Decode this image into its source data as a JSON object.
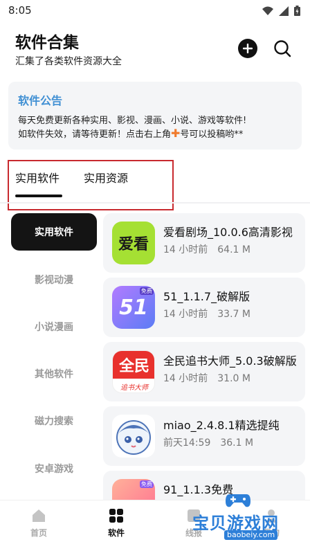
{
  "status_bar": {
    "time": "8:05"
  },
  "header": {
    "title": "软件合集",
    "subtitle": "汇集了各类软件资源大全"
  },
  "notice": {
    "title": "软件公告",
    "line1": "每天免费更新各种实用、影视、漫画、小说、游戏等软件!",
    "line2_pre": "如软件失效，请等待更新！点击右上角",
    "plus": "✚",
    "line2_post": "号可以投稿哟**"
  },
  "tabs": [
    {
      "label": "实用软件",
      "active": true
    },
    {
      "label": "实用资源",
      "active": false
    }
  ],
  "sidebar": {
    "items": [
      {
        "label": "实用软件",
        "active": true
      },
      {
        "label": "影视动漫"
      },
      {
        "label": "小说漫画"
      },
      {
        "label": "其他软件"
      },
      {
        "label": "磁力搜索"
      },
      {
        "label": "安卓游戏"
      }
    ]
  },
  "apps": [
    {
      "name": "爱看剧场_10.0.6高清影视",
      "time": "14 小时前",
      "size": "64.1 M",
      "icon": "aikan-app-icon",
      "icon_text": "爱看",
      "icon_bg": "#a5e033"
    },
    {
      "name": "51_1.1.7_破解版",
      "time": "14 小时前",
      "size": "33.7 M",
      "icon": "51-app-icon",
      "icon_text": "51",
      "badge": "免费",
      "icon_bg": "#8a6cf0"
    },
    {
      "name": "全民追书大师_5.0.3破解版",
      "time": "14 小时前",
      "size": "31.0 M",
      "icon": "quanmin-app-icon",
      "icon_text": "全民",
      "icon_subtext": "追书大师",
      "icon_bg": "#e8312d"
    },
    {
      "name": "miao_2.4.8.1精选提纯",
      "time": "前天14:59",
      "size": "36.1 M",
      "icon": "miao-app-icon"
    },
    {
      "name": "91_1.1.3免费",
      "time": "",
      "size": "",
      "icon": "91-app-icon",
      "badge": "免费"
    }
  ],
  "bottom_nav": {
    "items": [
      {
        "label": "首页",
        "icon": "home-icon"
      },
      {
        "label": "软件",
        "icon": "grid-icon",
        "active": true
      },
      {
        "label": "线报",
        "icon": "news-icon"
      },
      {
        "label": "我的",
        "icon": "user-icon"
      }
    ]
  },
  "watermark": {
    "text": "宝贝游戏网",
    "url": "baobeiy.com"
  },
  "colors": {
    "accent_blue": "#3f8fd3",
    "highlight_red": "#c8292e",
    "plus_orange": "#f07a2c"
  }
}
